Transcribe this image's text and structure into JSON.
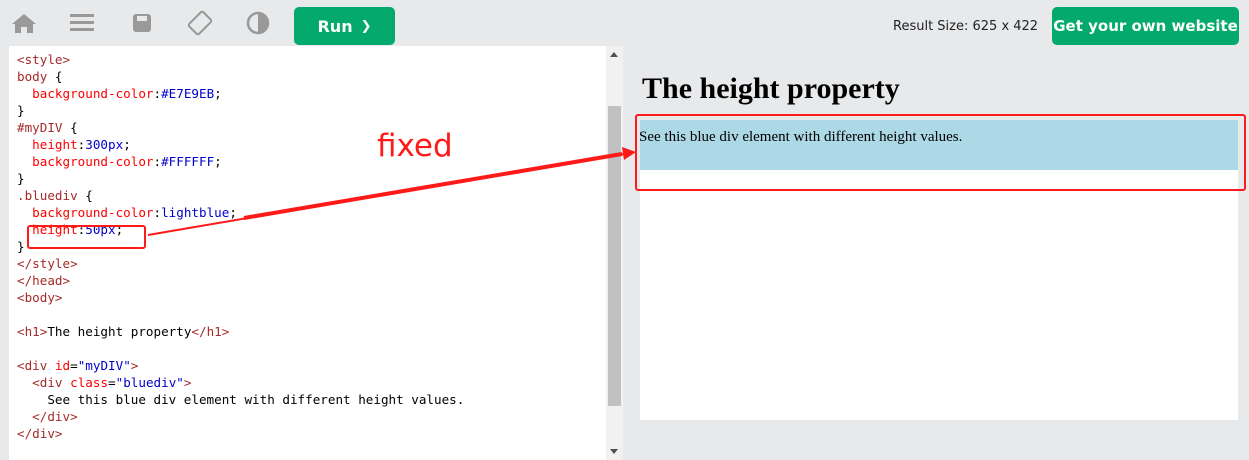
{
  "toolbar": {
    "run_label": "Run",
    "run_chevron": "❯",
    "result_size": "Result Size: 625 x 422",
    "get_website_label": "Get your own website"
  },
  "code": {
    "lines": [
      "<style>",
      "body {",
      "  background-color:#E7E9EB;",
      "}",
      "#myDIV {",
      "  height:300px;",
      "  background-color:#FFFFFF;",
      "}",
      ".bluediv {",
      "  background-color:lightblue;",
      "  height:50px;",
      "}",
      "</style>",
      "</head>",
      "<body>",
      "",
      "<h1>The height property</h1>",
      "",
      "<div id=\"myDIV\">",
      "  <div class=\"bluediv\">",
      "    See this blue div element with different height values.",
      "  </div>",
      "</div>"
    ]
  },
  "result": {
    "heading": "The height property",
    "bluediv_text": "See this blue div element with different height values."
  },
  "annotation": {
    "label": "fixed",
    "color": "#ff1a1a"
  },
  "colors": {
    "accent_green": "#04aa6d",
    "page_bg": "#E7E9EB",
    "bluediv_bg": "lightblue"
  }
}
